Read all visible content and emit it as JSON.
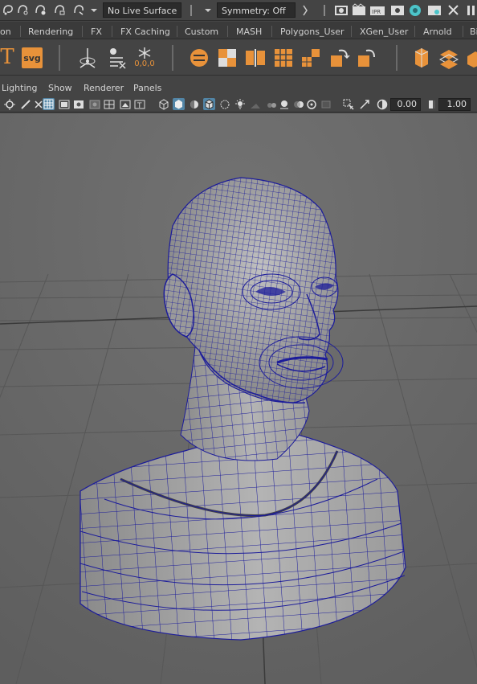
{
  "status_line": {
    "live_surface_label": "No Live Surface",
    "symmetry_label": "Symmetry: Off"
  },
  "shelf": {
    "tabs": [
      "on",
      "Rendering",
      "FX",
      "FX Caching",
      "Custom",
      "MASH",
      "Polygons_User",
      "XGen_User",
      "Arnold",
      "Bi"
    ],
    "text_icon_label": "T",
    "svg_icon_label": "svg",
    "snowflake_values": "0,0,0"
  },
  "panel": {
    "menus": [
      "Lighting",
      "Show",
      "Renderer",
      "Panels"
    ],
    "exposure_value": "0.00",
    "gamma_value": "1.00"
  },
  "colors": {
    "accent_orange": "#e8923a",
    "toggle_blue": "#5285a6",
    "wireframe_blue": "#1c1c9a",
    "viewport_bg": "#6a6a6a"
  }
}
